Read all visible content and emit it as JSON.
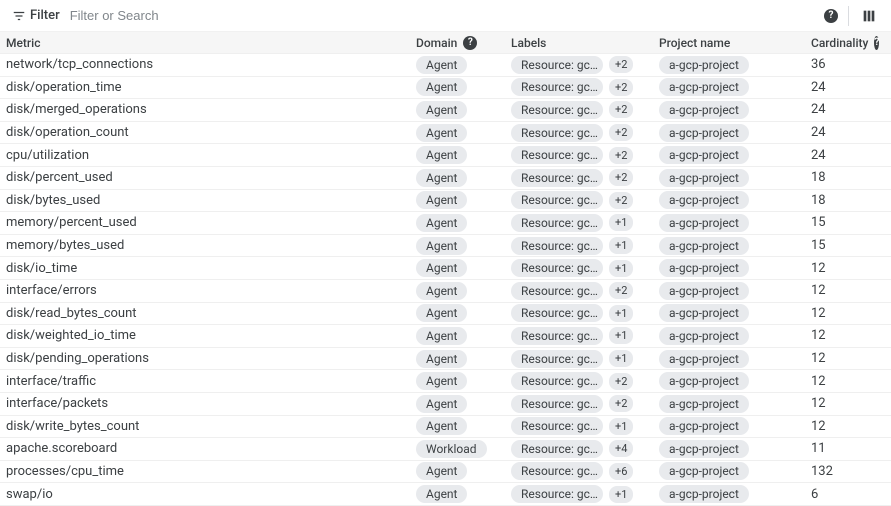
{
  "toolbar": {
    "filter_label": "Filter",
    "search_placeholder": "Filter or Search"
  },
  "headers": {
    "metric": "Metric",
    "domain": "Domain",
    "labels": "Labels",
    "project": "Project name",
    "cardinality": "Cardinality"
  },
  "resource_chip_text": "Resource: gc…",
  "rows": [
    {
      "metric": "network/tcp_connections",
      "domain": "Agent",
      "extra": "+2",
      "project": "a-gcp-project",
      "cardinality": "36"
    },
    {
      "metric": "disk/operation_time",
      "domain": "Agent",
      "extra": "+2",
      "project": "a-gcp-project",
      "cardinality": "24"
    },
    {
      "metric": "disk/merged_operations",
      "domain": "Agent",
      "extra": "+2",
      "project": "a-gcp-project",
      "cardinality": "24"
    },
    {
      "metric": "disk/operation_count",
      "domain": "Agent",
      "extra": "+2",
      "project": "a-gcp-project",
      "cardinality": "24"
    },
    {
      "metric": "cpu/utilization",
      "domain": "Agent",
      "extra": "+2",
      "project": "a-gcp-project",
      "cardinality": "24"
    },
    {
      "metric": "disk/percent_used",
      "domain": "Agent",
      "extra": "+2",
      "project": "a-gcp-project",
      "cardinality": "18"
    },
    {
      "metric": "disk/bytes_used",
      "domain": "Agent",
      "extra": "+2",
      "project": "a-gcp-project",
      "cardinality": "18"
    },
    {
      "metric": "memory/percent_used",
      "domain": "Agent",
      "extra": "+1",
      "project": "a-gcp-project",
      "cardinality": "15"
    },
    {
      "metric": "memory/bytes_used",
      "domain": "Agent",
      "extra": "+1",
      "project": "a-gcp-project",
      "cardinality": "15"
    },
    {
      "metric": "disk/io_time",
      "domain": "Agent",
      "extra": "+1",
      "project": "a-gcp-project",
      "cardinality": "12"
    },
    {
      "metric": "interface/errors",
      "domain": "Agent",
      "extra": "+2",
      "project": "a-gcp-project",
      "cardinality": "12"
    },
    {
      "metric": "disk/read_bytes_count",
      "domain": "Agent",
      "extra": "+1",
      "project": "a-gcp-project",
      "cardinality": "12"
    },
    {
      "metric": "disk/weighted_io_time",
      "domain": "Agent",
      "extra": "+1",
      "project": "a-gcp-project",
      "cardinality": "12"
    },
    {
      "metric": "disk/pending_operations",
      "domain": "Agent",
      "extra": "+1",
      "project": "a-gcp-project",
      "cardinality": "12"
    },
    {
      "metric": "interface/traffic",
      "domain": "Agent",
      "extra": "+2",
      "project": "a-gcp-project",
      "cardinality": "12"
    },
    {
      "metric": "interface/packets",
      "domain": "Agent",
      "extra": "+2",
      "project": "a-gcp-project",
      "cardinality": "12"
    },
    {
      "metric": "disk/write_bytes_count",
      "domain": "Agent",
      "extra": "+1",
      "project": "a-gcp-project",
      "cardinality": "12"
    },
    {
      "metric": "apache.scoreboard",
      "domain": "Workload",
      "extra": "+4",
      "project": "a-gcp-project",
      "cardinality": "11"
    },
    {
      "metric": "processes/cpu_time",
      "domain": "Agent",
      "extra": "+6",
      "project": "a-gcp-project",
      "cardinality": "132"
    },
    {
      "metric": "swap/io",
      "domain": "Agent",
      "extra": "+1",
      "project": "a-gcp-project",
      "cardinality": "6"
    }
  ]
}
